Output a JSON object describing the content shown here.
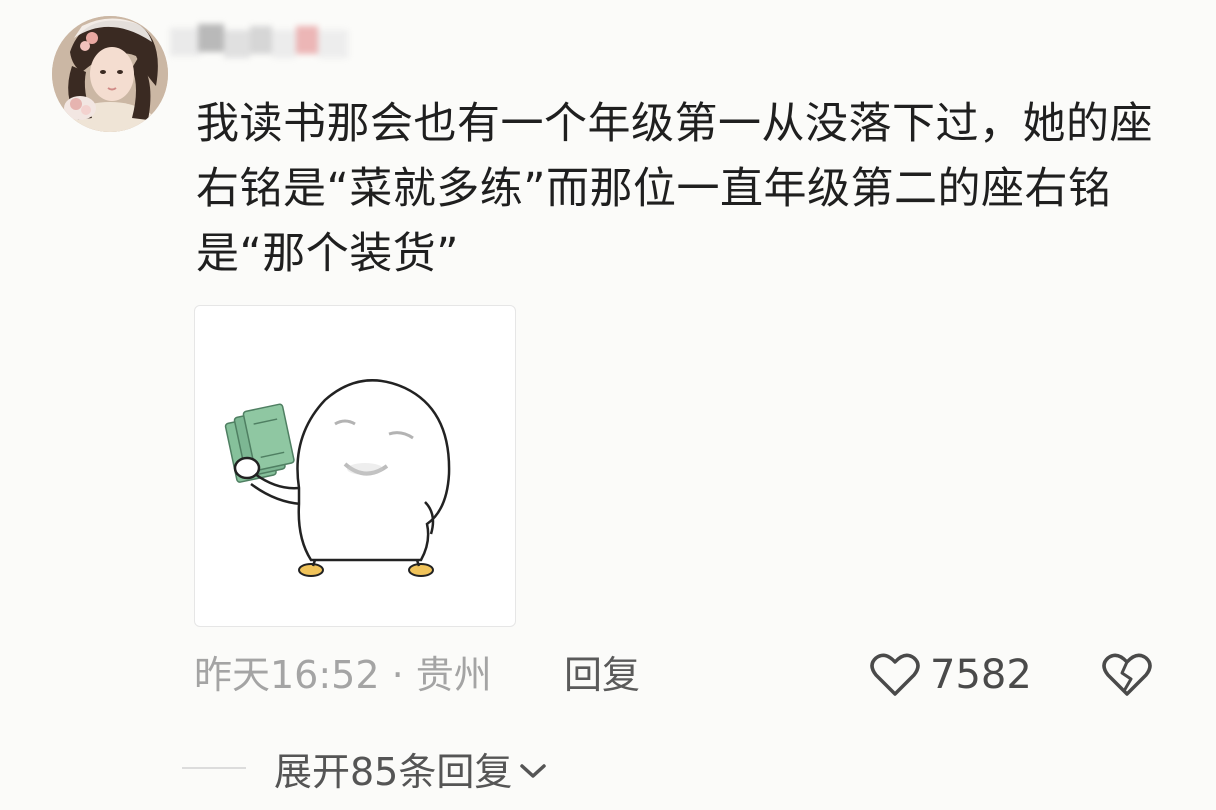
{
  "comment": {
    "username": "",
    "text": "我读书那会也有一个年级第一从没落下过，她的座右铭是“菜就多练”而那位一直年级第二的座右铭是“那个装货”",
    "sticker_icon": "meme-sticker-holding-money",
    "meta": {
      "time_location": "昨天16:52 · 贵州",
      "reply_label": "回复",
      "like_count": "7582"
    },
    "expand_label": "展开85条回复"
  },
  "icons": {
    "like": "heart-outline-icon",
    "dislike": "broken-heart-icon",
    "expand": "chevron-down-icon"
  },
  "colors": {
    "background": "#fbfbf9",
    "text": "#1f1f1f",
    "meta": "#a4a4a4",
    "money": "#7db793"
  }
}
